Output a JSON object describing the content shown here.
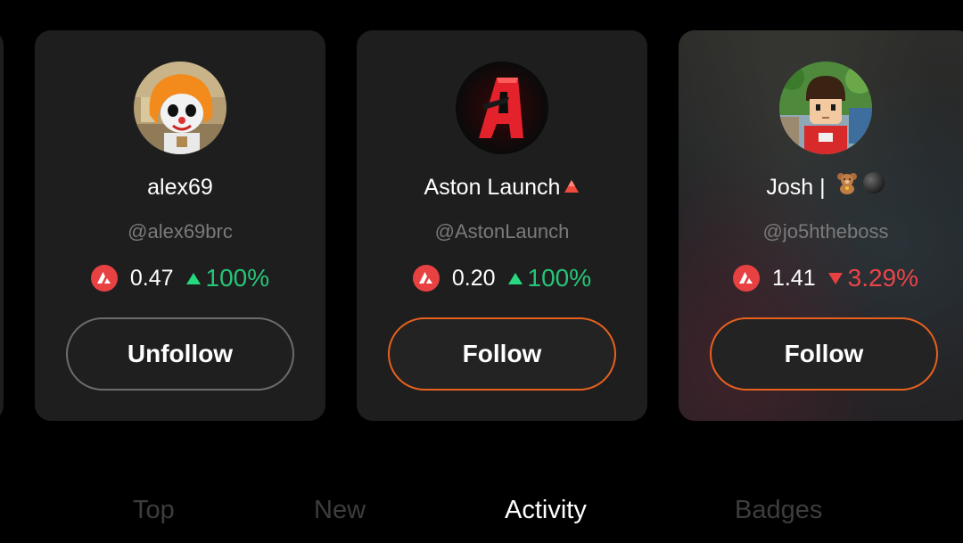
{
  "cards": [
    {
      "name": "alex69",
      "handle": "@alex69brc",
      "price": "0.47",
      "change": "100%",
      "change_direction": "up",
      "button_label": "Unfollow",
      "avatar_icon": "clown-avatar"
    },
    {
      "name": "Aston Launch",
      "name_badge": "red-triangle-icon",
      "handle": "@AstonLaunch",
      "price": "0.20",
      "change": "100%",
      "change_direction": "up",
      "button_label": "Follow",
      "avatar_icon": "red-a-logo-avatar"
    },
    {
      "name": "Josh | ",
      "name_badge": "teddy-bear-and-black-circle-emoji",
      "handle": "@jo5htheboss",
      "price": "1.41",
      "change": "3.29%",
      "change_direction": "down",
      "button_label": "Follow",
      "avatar_icon": "pixel-character-avatar"
    }
  ],
  "token_icon": "avalanche-icon",
  "tabs": [
    {
      "label": "Top",
      "active": false
    },
    {
      "label": "New",
      "active": false
    },
    {
      "label": "Activity",
      "active": true
    },
    {
      "label": "Badges",
      "active": false
    }
  ],
  "colors": {
    "background": "#000000",
    "card": "#1e1e1e",
    "accent_orange": "#e8611e",
    "up_green": "#26c478",
    "down_red": "#e8454a",
    "token_red": "#e84142"
  }
}
